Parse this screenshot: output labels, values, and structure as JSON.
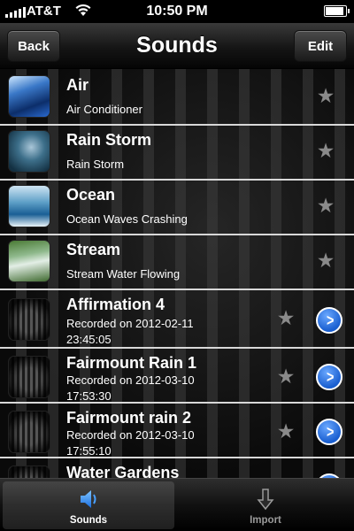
{
  "status_bar": {
    "carrier": "AT&T",
    "time": "10:50 PM"
  },
  "nav": {
    "back_label": "Back",
    "title": "Sounds",
    "edit_label": "Edit"
  },
  "sounds": [
    {
      "title": "Air",
      "subtitle": "Air Conditioner",
      "thumbnail": "air-conditioner-thumbnail"
    },
    {
      "title": "Rain Storm",
      "subtitle": "Rain Storm",
      "thumbnail": "rain-storm-thumbnail"
    },
    {
      "title": "Ocean",
      "subtitle": "Ocean Waves Crashing",
      "thumbnail": "ocean-thumbnail"
    },
    {
      "title": "Stream",
      "subtitle": "Stream Water Flowing",
      "thumbnail": "stream-thumbnail"
    }
  ],
  "recordings": [
    {
      "title": "Affirmation 4",
      "line1": "Recorded on 2012-02-11",
      "line2": "23:45:05"
    },
    {
      "title": "Fairmount Rain 1",
      "line1": "Recorded on 2012-03-10",
      "line2": "17:53:30"
    },
    {
      "title": "Fairmount rain 2",
      "line1": "Recorded on 2012-03-10",
      "line2": "17:55:10"
    },
    {
      "title": "Water Gardens"
    }
  ],
  "tabs": [
    {
      "label": "Sounds",
      "icon": "speaker-icon",
      "selected": true
    },
    {
      "label": "Import",
      "icon": "download-arrow-icon",
      "selected": false
    }
  ],
  "colors": {
    "accent_blue": "#1a5fd0",
    "star_gray": "#8a8a8a",
    "separator": "#d8d8d8"
  }
}
